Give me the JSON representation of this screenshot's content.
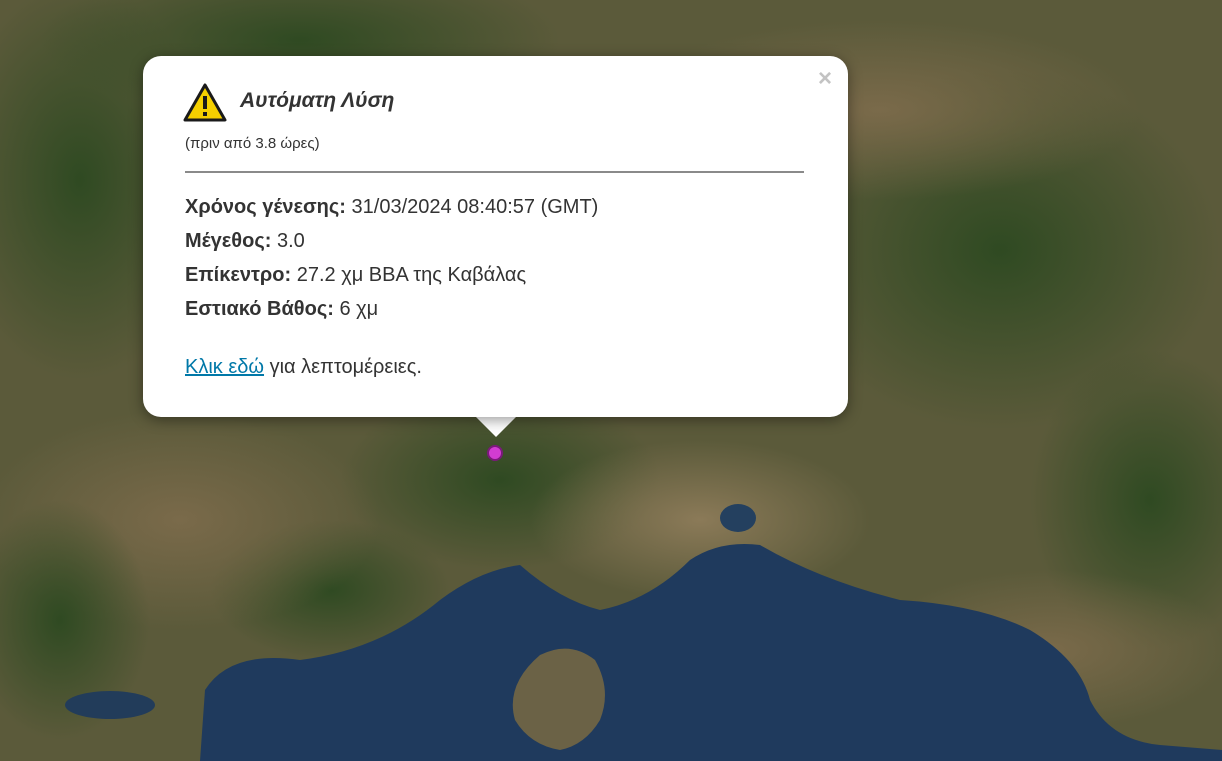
{
  "popup": {
    "title": "Αυτόματη Λύση",
    "subtitle": "(πριν από 3.8 ώρες)",
    "close_label": "×",
    "icon": "warning-triangle-icon",
    "rows": [
      {
        "label": "Χρόνος γένεσης:",
        "value": "31/03/2024 08:40:57 (GMT)"
      },
      {
        "label": "Μέγεθος:",
        "value": "3.0"
      },
      {
        "label": "Επίκεντρο:",
        "value": "27.2 χμ ΒΒΑ της Καβάλας"
      },
      {
        "label": "Εστιακό Βάθος:",
        "value": "6 χμ"
      }
    ],
    "link_text": "Κλικ εδώ",
    "link_suffix": "για λεπτομέρειες."
  },
  "marker": {
    "icon": "epicenter-marker-icon",
    "color": "#d23cd2"
  },
  "colors": {
    "sea": "#1e3a5c",
    "link": "#0078a8",
    "warning": "#f5d000"
  }
}
